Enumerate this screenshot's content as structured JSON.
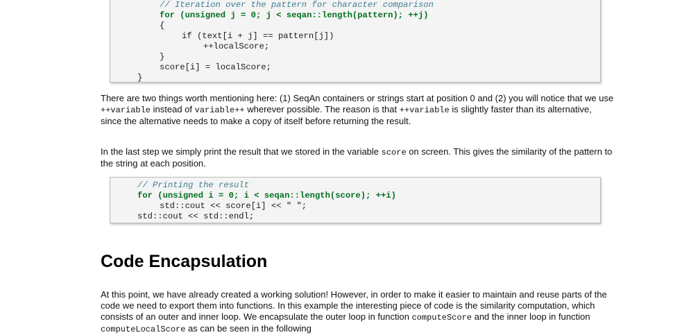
{
  "code_block_1": {
    "lines": [
      "// Iteration over the pattern for character comparison",
      "for (unsigned j = 0; j < seqan::length(pattern); ++j)",
      "{",
      "if (text[i + j] == pattern[j])",
      "++localScore;",
      "}",
      "score[i] = localScore;",
      "}"
    ]
  },
  "paragraph_1": {
    "t1": "There are two things worth mentioning here: (1) SeqAn containers or strings start at position 0 and (2) you will notice that we use ",
    "c1": "++variable",
    "t2": " instead of ",
    "c2": "variable++",
    "t3": " wherever possible. The reason is that ",
    "c3": "++variable",
    "t4": " is slightly faster than its alternative, since the alternative needs to make a copy of itself before returning the result."
  },
  "paragraph_2": {
    "t1": "In the last step we simply print the result that we stored in the variable ",
    "c1": "score",
    "t2": " on screen. This gives the similarity of the pattern to the string at each position."
  },
  "code_block_2": {
    "lines": [
      "// Printing the result",
      "for (unsigned i = 0; i < seqan::length(score); ++i)",
      "std::cout << score[i] << \" \";",
      "std::cout << std::endl;"
    ]
  },
  "section_heading": "Code Encapsulation",
  "paragraph_3": {
    "t1": "At this point, we have already created a working solution! However, in order to make it easier to maintain and reuse parts of the code we need to export them into functions. In this example the interesting piece of code is the similarity computation, which consists of an outer and inner loop. We encapsulate the outer loop in function ",
    "c1": "computeScore",
    "t2": " and the inner loop in function ",
    "c2": "computeLocalScore",
    "t3": " as can be seen in the following"
  }
}
